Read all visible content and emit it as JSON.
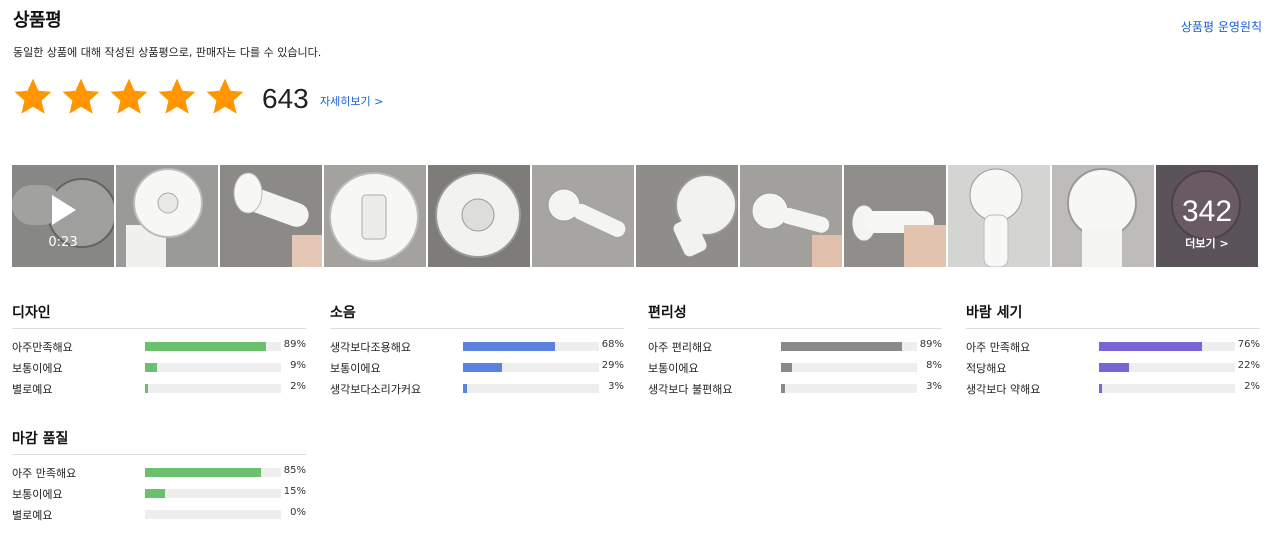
{
  "header": {
    "title": "상품평",
    "policy_link": "상품평 운영원칙",
    "description": "동일한 상품에 대해 작성된 상품평으로, 판매자는 다를 수 있습니다.",
    "review_count": "643",
    "detail_link": "자세히보기 >",
    "rating_stars": 5,
    "star_color": "#ff9600"
  },
  "photos": {
    "video_duration": "0:23",
    "more_count": "342",
    "more_label": "더보기 >"
  },
  "categories": [
    {
      "name": "디자인",
      "color": "#6cbf6c",
      "rows": [
        {
          "label": "아주만족해요",
          "pct": "89%",
          "value": 89
        },
        {
          "label": "보통이에요",
          "pct": "9%",
          "value": 9
        },
        {
          "label": "별로예요",
          "pct": "2%",
          "value": 2
        }
      ]
    },
    {
      "name": "소음",
      "color": "#5b82e0",
      "rows": [
        {
          "label": "생각보다조용해요",
          "pct": "68%",
          "value": 68
        },
        {
          "label": "보통이에요",
          "pct": "29%",
          "value": 29
        },
        {
          "label": "생각보다소리가커요",
          "pct": "3%",
          "value": 3
        }
      ]
    },
    {
      "name": "편리성",
      "color": "#8a8a8a",
      "rows": [
        {
          "label": "아주 편리해요",
          "pct": "89%",
          "value": 89
        },
        {
          "label": "보통이에요",
          "pct": "8%",
          "value": 8
        },
        {
          "label": "생각보다 불편해요",
          "pct": "3%",
          "value": 3
        }
      ]
    },
    {
      "name": "바람 세기",
      "color": "#7b64d6",
      "rows": [
        {
          "label": "아주 만족해요",
          "pct": "76%",
          "value": 76
        },
        {
          "label": "적당해요",
          "pct": "22%",
          "value": 22
        },
        {
          "label": "생각보다 약해요",
          "pct": "2%",
          "value": 2
        }
      ]
    },
    {
      "name": "마감 품질",
      "color": "#6cbf6c",
      "rows": [
        {
          "label": "아주 만족해요",
          "pct": "85%",
          "value": 85
        },
        {
          "label": "보통이에요",
          "pct": "15%",
          "value": 15
        },
        {
          "label": "별로예요",
          "pct": "0%",
          "value": 0
        }
      ]
    }
  ]
}
